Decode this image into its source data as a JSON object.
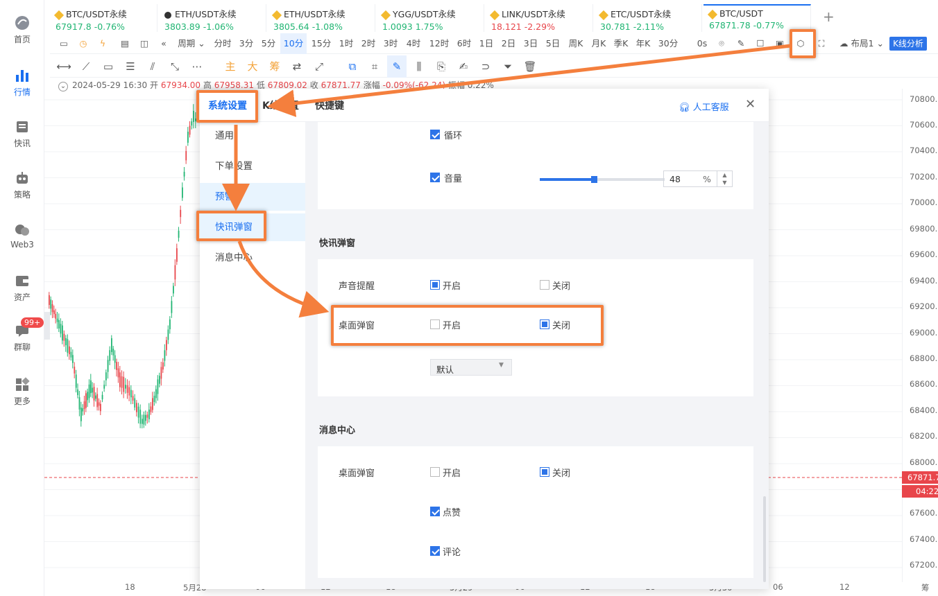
{
  "leftnav": {
    "items": [
      {
        "label": "首页",
        "icon": "home-icon"
      },
      {
        "label": "行情",
        "icon": "market-bar-icon"
      },
      {
        "label": "快讯",
        "icon": "news-icon"
      },
      {
        "label": "策略",
        "icon": "robot-icon"
      },
      {
        "label": "Web3",
        "icon": "web3-icon"
      },
      {
        "label": "资产",
        "icon": "wallet-icon"
      },
      {
        "label": "群聊",
        "icon": "chat-icon"
      },
      {
        "label": "更多",
        "icon": "grid-icon"
      }
    ],
    "chat_badge": "99+"
  },
  "tabs": [
    {
      "name": "BTC/USDT永续",
      "price": "67917.8",
      "change": "-0.76%",
      "dir": "up"
    },
    {
      "name": "ETH/USDT永续",
      "price": "3803.89",
      "change": "-1.06%",
      "dir": "up"
    },
    {
      "name": "ETH/USDT永续",
      "price": "3805.64",
      "change": "-1.08%",
      "dir": "up"
    },
    {
      "name": "YGG/USDT永续",
      "price": "1.0093",
      "change": "1.75%",
      "dir": "up"
    },
    {
      "name": "LINK/USDT永续",
      "price": "18.121",
      "change": "-2.29%",
      "dir": "dn"
    },
    {
      "name": "ETC/USDT永续",
      "price": "30.781",
      "change": "-2.11%",
      "dir": "up"
    },
    {
      "name": "BTC/USDT",
      "price": "67871.78",
      "change": "-0.77%",
      "dir": "up"
    }
  ],
  "add_tab": "+",
  "toolbar1": {
    "period_label": "周期",
    "intervals": [
      "分时",
      "3分",
      "5分",
      "10分",
      "15分",
      "1时",
      "2时",
      "3时",
      "4时",
      "12时",
      "6时",
      "1日",
      "2日",
      "3日",
      "5日",
      "周K",
      "月K",
      "季K",
      "年K",
      "30分"
    ],
    "selected": "10分",
    "zero_s": "0s",
    "layout_label": "布局1",
    "kline_btn": "K线分析"
  },
  "toolbar2": {
    "text_tools": [
      "主",
      "大",
      "筹"
    ]
  },
  "infoline": {
    "date": "2024-05-29 16:30",
    "open_label": "开",
    "open": "67934.00",
    "high_label": "高",
    "high": "67958.31",
    "low_label": "低",
    "low": "67809.02",
    "close_label": "收",
    "close": "67871.77",
    "change_label": "涨幅",
    "change": "-0.09%(-62.24)",
    "amp_label": "振幅",
    "amp": "0.22%"
  },
  "chart_data": {
    "type": "candlestick",
    "y_ticks": [
      "70800.0",
      "70600.0",
      "70400.0",
      "70200.0",
      "70000.0",
      "69800.0",
      "69600.0",
      "69400.0",
      "69200.0",
      "69000.0",
      "68800.0",
      "68600.0",
      "68400.0",
      "68200.0",
      "68000.0",
      "67871.7",
      "67600.0",
      "67400.0",
      "67200.0"
    ],
    "x_ticks": [
      "18",
      "5月28",
      "06",
      "12",
      "18",
      "5月29",
      "06",
      "12",
      "18",
      "5月30",
      "06",
      "12",
      "筹"
    ],
    "last_price": "67871.7",
    "countdown": "04:22",
    "ylim": [
      67200,
      70800
    ]
  },
  "dialog": {
    "tabs": [
      "系统设置",
      "K线设置",
      "快捷键"
    ],
    "selected_tab": "系统设置",
    "service_label": "人工客服",
    "side": [
      "通用",
      "下单设置",
      "预警",
      "快讯弹窗",
      "消息中心"
    ],
    "selected_side": "预警",
    "alert_card": {
      "loop_label": "循环",
      "volume_label": "音量",
      "volume_value": "48",
      "volume_unit": "%",
      "volume_level": 0.48
    },
    "news_section": {
      "title": "快讯弹窗",
      "sound_label": "声音提醒",
      "popup_label": "桌面弹窗",
      "on_label": "开启",
      "off_label": "关闭",
      "select_value": "默认"
    },
    "msg_section": {
      "title": "消息中心",
      "popup_label": "桌面弹窗",
      "on_label": "开启",
      "off_label": "关闭",
      "like_label": "点赞",
      "comment_label": "评论"
    }
  }
}
